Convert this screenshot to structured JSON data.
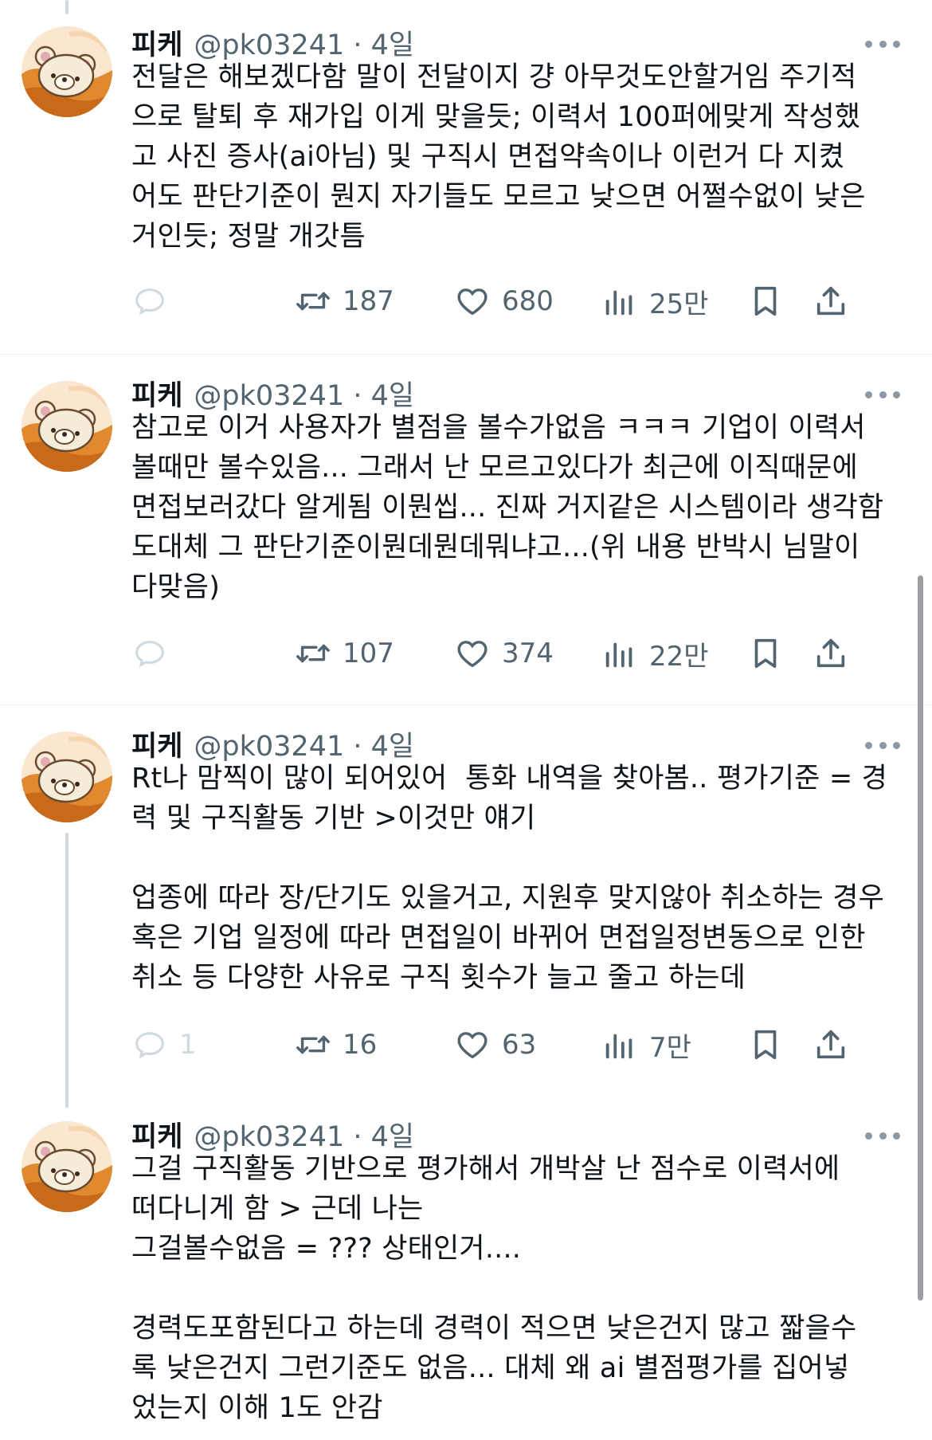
{
  "tweets": [
    {
      "name": "피케",
      "handle": "@pk03241",
      "time": "4일",
      "text": "전달은 해보겠다함 말이 전달이지 걍 아무것도안할거임 주기적\n으로 탈퇴 후 재가입 이게 맞을듯; 이력서 100퍼에맞게 작성했\n고 사진 증사(ai아님) 및 구직시 면접약속이나 이런거 다 지켰\n어도 판단기준이 뭔지 자기들도 모르고 낮으면 어쩔수없이 낮은\n거인듯; 정말 개갓틈",
      "reply_count": "",
      "retweet_count": "187",
      "like_count": "680",
      "view_count": "25만"
    },
    {
      "name": "피케",
      "handle": "@pk03241",
      "time": "4일",
      "text": "참고로 이거 사용자가 별점을 볼수가없음 ㅋㅋㅋ 기업이 이력서\n볼때만 볼수있음... 그래서 난 모르고있다가 최근에 이직때문에\n면접보러갔다 알게됨 이뭔씹... 진짜 거지같은 시스템이라 생각함\n도대체 그 판단기준이뭔데뭔데뭐냐고...(위 내용 반박시 님말이\n다맞음)",
      "reply_count": "",
      "retweet_count": "107",
      "like_count": "374",
      "view_count": "22만"
    },
    {
      "name": "피케",
      "handle": "@pk03241",
      "time": "4일",
      "text": "Rt나 맘찍이 많이 되어있어  통화 내역을 찾아봄.. 평가기준 = 경\n력 및 구직활동 기반 >이것만 얘기\n\n업종에 따라 장/단기도 있을거고, 지원후 맞지않아 취소하는 경우\n혹은 기업 일정에 따라 면접일이 바뀌어 면접일정변동으로 인한\n취소 등 다양한 사유로 구직 횟수가 늘고 줄고 하는데",
      "reply_count": "1",
      "retweet_count": "16",
      "like_count": "63",
      "view_count": "7만"
    },
    {
      "name": "피케",
      "handle": "@pk03241",
      "time": "4일",
      "text": "그걸 구직활동 기반으로 평가해서 개박살 난 점수로 이력서에\n떠다니게 함 > 근데 나는\n그걸볼수없음 = ??? 상태인거....\n\n경력도포함된다고 하는데 경력이 적으면 낮은건지 많고 짧을수\n록 낮은건지 그런기준도 없음... 대체 왜 ai 별점평가를 집어넣\n었는지 이해 1도 안감"
    }
  ],
  "colors": {
    "text": "#0f1419",
    "secondary": "#536471",
    "divider": "#eff3f4",
    "thread_line": "#cfd9de"
  },
  "icons": [
    "avatar-rilakkuma",
    "more-icon",
    "reply-icon",
    "retweet-icon",
    "like-icon",
    "views-icon",
    "bookmark-icon",
    "share-icon"
  ]
}
